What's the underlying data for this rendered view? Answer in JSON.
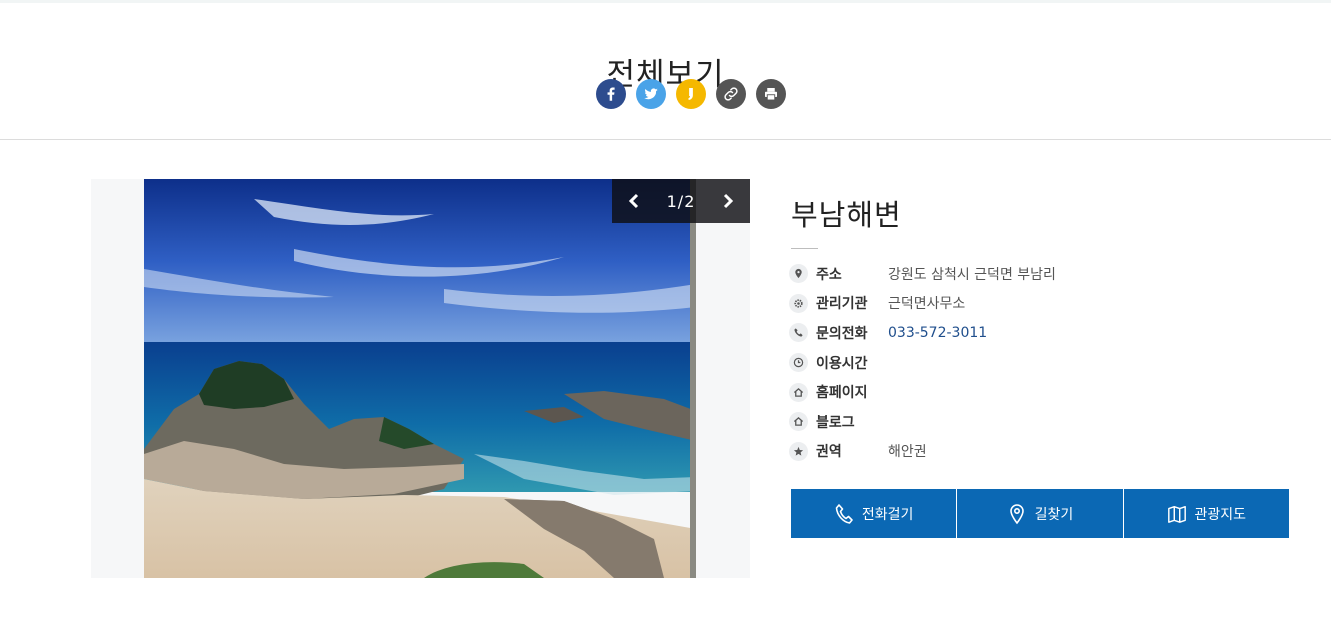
{
  "header": {
    "title": "전체보기",
    "share": [
      {
        "name": "facebook",
        "icon": "facebook-icon",
        "color": "#2d4c8e"
      },
      {
        "name": "twitter",
        "icon": "twitter-icon",
        "color": "#4aa3e8"
      },
      {
        "name": "kakaostory",
        "icon": "kakaostory-icon",
        "color": "#f5b800"
      },
      {
        "name": "link",
        "icon": "link-icon",
        "color": "#555555"
      },
      {
        "name": "print",
        "icon": "print-icon",
        "color": "#555555"
      }
    ]
  },
  "gallery": {
    "current": "1",
    "total": "2",
    "counter": "1/2",
    "prev_icon": "chevron-left-icon",
    "next_icon": "chevron-right-icon"
  },
  "place": {
    "name": "부남해변",
    "info": [
      {
        "icon": "location-pin-icon",
        "label": "주소",
        "value": "강원도 삼척시 근덕면 부남리"
      },
      {
        "icon": "gear-icon",
        "label": "관리기관",
        "value": "근덕면사무소"
      },
      {
        "icon": "phone-icon",
        "label": "문의전화",
        "value": "033-572-3011"
      },
      {
        "icon": "clock-icon",
        "label": "이용시간",
        "value": ""
      },
      {
        "icon": "home-icon",
        "label": "홈페이지",
        "value": ""
      },
      {
        "icon": "home-icon",
        "label": "블로그",
        "value": ""
      },
      {
        "icon": "star-icon",
        "label": "권역",
        "value": "해안권"
      }
    ]
  },
  "actions": {
    "call_label": "전화걸기",
    "directions_label": "길찾기",
    "map_label": "관광지도",
    "accent": "#0b68b4"
  }
}
